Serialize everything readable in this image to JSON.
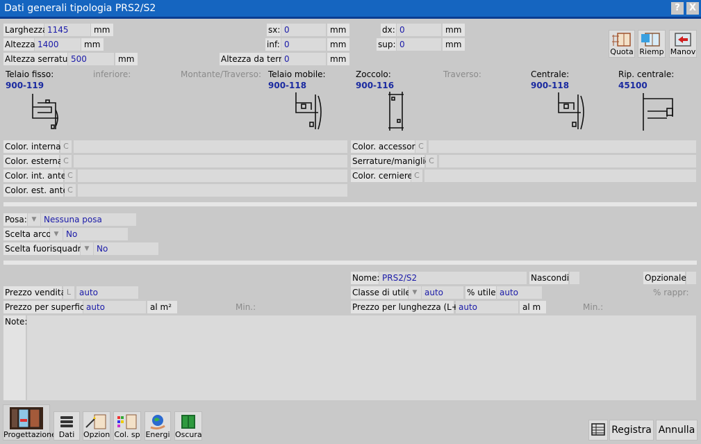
{
  "window": {
    "title": "Dati generali tipologia PRS2/S2",
    "help_label": "?",
    "close_label": "X"
  },
  "dims": {
    "larghezza_label": "Larghezza:",
    "larghezza_value": "1145",
    "larghezza_unit": "mm",
    "altezza_label": "Altezza:",
    "altezza_value": "1400",
    "altezza_unit": "mm",
    "altezza_serratura_label": "Altezza serratura:",
    "altezza_serratura_value": "500",
    "altezza_serratura_unit": "mm",
    "sx_label": "sx:",
    "sx_value": "0",
    "sx_unit": "mm",
    "inf_label": "inf:",
    "inf_value": "0",
    "inf_unit": "mm",
    "altezza_terra_label": "Altezza da terra:",
    "altezza_terra_value": "0",
    "altezza_terra_unit": "mm",
    "dx_label": "dx:",
    "dx_value": "0",
    "dx_unit": "mm",
    "sup_label": "sup:",
    "sup_value": "0",
    "sup_unit": "mm"
  },
  "tools": [
    {
      "label": "Quota"
    },
    {
      "label": "Riemp"
    },
    {
      "label": "Manov"
    }
  ],
  "profiles": {
    "telaio_fisso_label": "Telaio fisso:",
    "telaio_fisso_code": "900-119",
    "inferiore_label": "inferiore:",
    "montante_label": "Montante/Traverso:",
    "telaio_mobile_label": "Telaio mobile:",
    "telaio_mobile_code": "900-118",
    "zoccolo_label": "Zoccolo:",
    "zoccolo_code": "900-116",
    "traverso_label": "Traverso:",
    "centrale_label": "Centrale:",
    "centrale_code": "900-118",
    "rip_centrale_label": "Rip. centrale:",
    "rip_centrale_code": "45100"
  },
  "colors": {
    "color_interna": "Color. interna:",
    "color_esterna": "Color. esterna:",
    "color_int_ante": "Color. int. ante:",
    "color_est_ante": "Color. est. ante:",
    "color_accessori": "Color. accessori:",
    "serrature_maniglie": "Serrature/maniglie:",
    "color_cerniere": "Color. cerniere:",
    "c_letter": "C"
  },
  "posa": {
    "posa_label": "Posa:",
    "posa_value": "Nessuna posa",
    "arco_label": "Scelta arco:",
    "arco_value": "No",
    "fuori_label": "Scelta fuorisquadra:",
    "fuori_value": "No"
  },
  "pricing": {
    "nome_label": "Nome:",
    "nome_value": "PRS2/S2",
    "nascondi_label": "Nascondi:",
    "opzionale_label": "Opzionale:",
    "prezzo_vendita_label": "Prezzo vendita:",
    "prezzo_vendita_flag": "L",
    "prezzo_vendita_value": "auto",
    "classe_label": "Classe di utile:",
    "classe_value": "auto",
    "perc_utile_label": "% utile:",
    "perc_utile_value": "auto",
    "perc_rappr_label": "% rappr:",
    "prezzo_sup_label": "Prezzo per superficie:",
    "prezzo_sup_value": "auto",
    "prezzo_sup_unit": "al m²",
    "min1_label": "Min.:",
    "prezzo_lung_label": "Prezzo per lunghezza (L+H):",
    "prezzo_lung_value": "auto",
    "prezzo_lung_unit": "al m",
    "min2_label": "Min.:",
    "note_label": "Note:"
  },
  "bottom": {
    "progettazione": "Progettazione",
    "dati": "Dati",
    "opzion": "Opzion",
    "colsp": "Col. sp",
    "energi": "Energi",
    "oscura": "Oscura",
    "registra": "Registra",
    "annulla": "Annulla"
  }
}
